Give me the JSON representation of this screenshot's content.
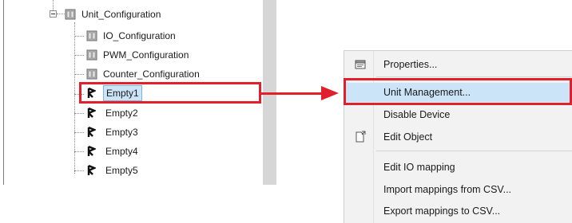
{
  "tree": {
    "root": {
      "label": "Unit_Configuration"
    },
    "children": [
      {
        "label": "IO_Configuration",
        "kind": "device"
      },
      {
        "label": "PWM_Configuration",
        "kind": "device"
      },
      {
        "label": "Counter_Configuration",
        "kind": "device"
      },
      {
        "label": "Empty1",
        "kind": "slot",
        "selected": true
      },
      {
        "label": "Empty2",
        "kind": "slot"
      },
      {
        "label": "Empty3",
        "kind": "slot"
      },
      {
        "label": "Empty4",
        "kind": "slot"
      },
      {
        "label": "Empty5",
        "kind": "slot"
      }
    ]
  },
  "context_menu": {
    "items": [
      {
        "label": "Properties...",
        "icon": "properties-icon"
      },
      {
        "label": "Unit Management...",
        "highlighted": true
      },
      {
        "label": "Disable Device"
      },
      {
        "label": "Edit Object",
        "icon": "edit-object-icon"
      },
      {
        "label": "Edit IO mapping"
      },
      {
        "label": "Import mappings from CSV..."
      },
      {
        "label": "Export mappings to CSV..."
      }
    ]
  },
  "colors": {
    "highlight_red": "#e0202a",
    "selection_blue": "#cce4f7",
    "menu_bg": "#f2f2f2"
  }
}
